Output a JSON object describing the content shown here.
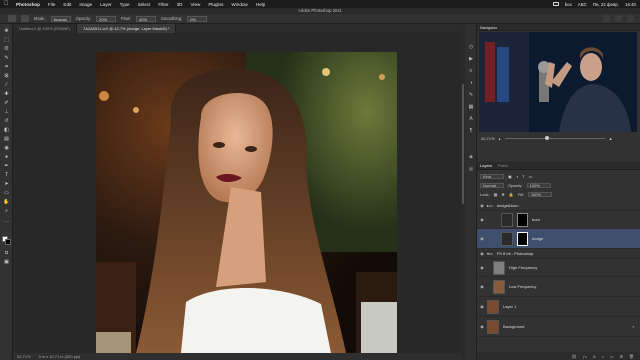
{
  "menubar": {
    "app": "Photoshop",
    "items": [
      "File",
      "Edit",
      "Image",
      "Layer",
      "Type",
      "Select",
      "Filter",
      "3D",
      "View",
      "Plugins",
      "Window",
      "Help"
    ],
    "right": [
      "box",
      "ABC",
      "Пн, 22 февр.",
      "16:40"
    ]
  },
  "window": {
    "title": "Adobe Photoshop 2021"
  },
  "options": {
    "mode_label": "Mode:",
    "mode_value": "Normal",
    "opacity_label": "Opacity:",
    "opacity_value": "20%",
    "flow_label": "Flow:",
    "flow_value": "40%",
    "smoothing_label": "Smoothing:",
    "smoothing_value": "0%"
  },
  "tabs": [
    {
      "label": "Untitled-1 @ 100% (RGB/8*)"
    },
    {
      "label": "7A1A0911.cr2 @ 42,7% (dodge, Layer Mask/8) *"
    }
  ],
  "status": {
    "zoom": "42,71%",
    "info": "5 in x 10,71 in (300 ppi)"
  },
  "navigator": {
    "tab": "Navigator",
    "zoom": "42,71%"
  },
  "layers": {
    "tabs": [
      "Layers",
      "Paths"
    ],
    "filter": "Kind",
    "blend": "Normal",
    "opacity_label": "Opacity:",
    "opacity": "100%",
    "lock_label": "Lock:",
    "fill_label": "Fill:",
    "fill": "100%",
    "items": [
      {
        "name": "dodge&burn"
      },
      {
        "name": "burn"
      },
      {
        "name": "dodge"
      },
      {
        "name": "FS 8 bit - Photoshop"
      },
      {
        "name": "High Frequency"
      },
      {
        "name": "Low Frequency"
      },
      {
        "name": "Layer 1"
      },
      {
        "name": "Background"
      }
    ]
  },
  "colors": {
    "selected_layer": "#3d4f6b",
    "panel": "#323232",
    "canvas_bg": "#282828"
  }
}
